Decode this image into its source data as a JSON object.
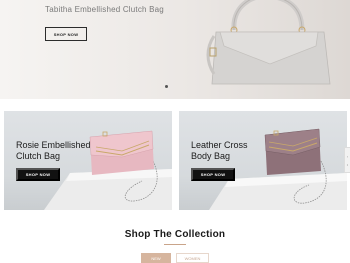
{
  "hero": {
    "title": "Tabitha Embellished Clutch Bag",
    "button_label": "SHOP NOW"
  },
  "promos": [
    {
      "title_line1": "Rosie Embellished",
      "title_line2": "Clutch Bag",
      "button_label": "SHOP NOW",
      "bag_color": "#e7b8c1"
    },
    {
      "title_line1": "Leather Cross",
      "title_line2": "Body Bag",
      "button_label": "SHOP NOW",
      "bag_color": "#8e7179"
    }
  ],
  "collection": {
    "title": "Shop The Collection",
    "tabs": [
      "NEW",
      "WOMEN"
    ],
    "accent": "#d6b59e"
  }
}
